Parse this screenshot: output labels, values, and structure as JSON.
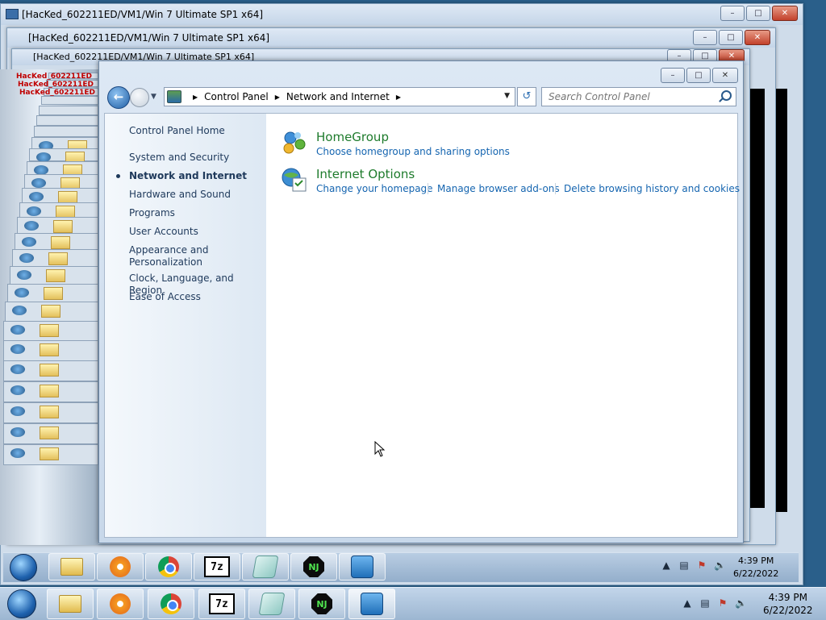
{
  "outer_windows": [
    {
      "title": "[HacKed_602211ED/VM1/Win 7 Ultimate SP1 x64]"
    },
    {
      "title": "[HacKed_602211ED/VM1/Win 7 Ultimate SP1 x64]"
    },
    {
      "title": "[HacKed_602211ED/VM1/Win 7 Ultimate SP1 x64]"
    }
  ],
  "echo_labels": [
    "HacKed_602211ED",
    "HacKed_602211ED",
    "HacKed_602211ED"
  ],
  "address_bar": {
    "crumbs": [
      "Control Panel",
      "Network and Internet"
    ]
  },
  "search": {
    "placeholder": "Search Control Panel"
  },
  "sidebar": {
    "home": "Control Panel Home",
    "items": [
      "System and Security",
      "Network and Internet",
      "Hardware and Sound",
      "Programs",
      "User Accounts",
      "Appearance and Personalization",
      "Clock, Language, and Region",
      "Ease of Access"
    ],
    "current": "Network and Internet"
  },
  "categories": [
    {
      "title": "HomeGroup",
      "links": [
        "Choose homegroup and sharing options"
      ]
    },
    {
      "title": "Internet Options",
      "links": [
        "Change your homepage",
        "Manage browser add-ons",
        "Delete browsing history and cookies"
      ]
    }
  ],
  "taskbar": {
    "apps": [
      "folder-icon",
      "media-player-icon",
      "chrome-icon",
      "7zip-icon",
      "sticky-notes-icon",
      "nj-icon",
      "control-panel-icon"
    ],
    "clock": {
      "time": "4:39 PM",
      "date": "6/22/2022"
    }
  },
  "inner_taskbar": {
    "clock": {
      "time": "4:39 PM",
      "date": "6/22/2022"
    }
  },
  "colors": {
    "link": "#1565b0",
    "category_title": "#1e7b2c",
    "sidebar_text": "#1e395b"
  }
}
